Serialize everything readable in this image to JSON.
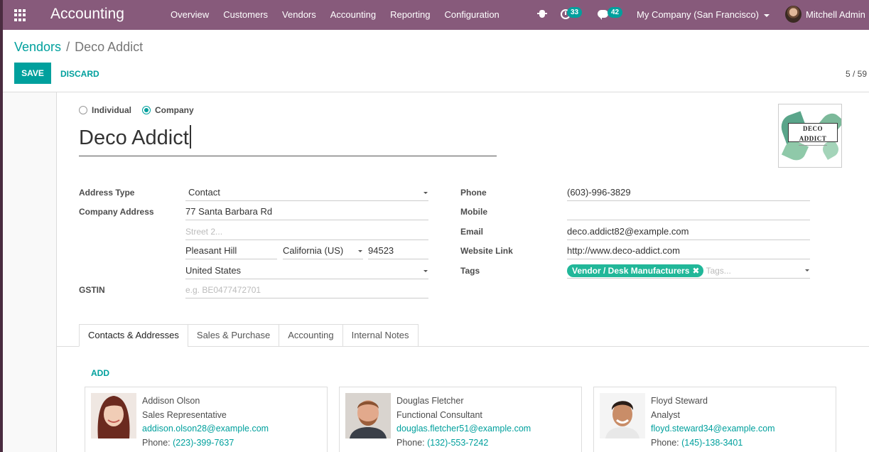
{
  "navbar": {
    "brand": "Accounting",
    "menu": [
      "Overview",
      "Customers",
      "Vendors",
      "Accounting",
      "Reporting",
      "Configuration"
    ],
    "activity_count": "33",
    "message_count": "42",
    "company": "My Company (San Francisco)",
    "user": "Mitchell Admin"
  },
  "breadcrumb": {
    "parent": "Vendors",
    "separator": "/",
    "current": "Deco Addict"
  },
  "buttons": {
    "save": "SAVE",
    "discard": "DISCARD"
  },
  "pager": "5 / 59",
  "form": {
    "company_type": {
      "individual": "Individual",
      "company": "Company",
      "selected": "company"
    },
    "name": "Deco Addict",
    "logo_text": "DECO ADDICT",
    "left": {
      "address_type_label": "Address Type",
      "address_type": "Contact",
      "company_address_label": "Company Address",
      "street": "77 Santa Barbara Rd",
      "street2_placeholder": "Street 2...",
      "city": "Pleasant Hill",
      "state": "California (US)",
      "zip": "94523",
      "country": "United States",
      "gstin_label": "GSTIN",
      "gstin_placeholder": "e.g. BE0477472701"
    },
    "right": {
      "phone_label": "Phone",
      "phone": "(603)-996-3829",
      "mobile_label": "Mobile",
      "mobile": "",
      "email_label": "Email",
      "email": "deco.addict82@example.com",
      "website_label": "Website Link",
      "website": "http://www.deco-addict.com",
      "tags_label": "Tags",
      "tag": "Vendor / Desk Manufacturers",
      "tags_placeholder": "Tags..."
    }
  },
  "tabs": [
    "Contacts & Addresses",
    "Sales & Purchase",
    "Accounting",
    "Internal Notes"
  ],
  "add_label": "ADD",
  "contacts": [
    {
      "name": "Addison Olson",
      "title": "Sales Representative",
      "email": "addison.olson28@example.com",
      "phone_label": "Phone:",
      "phone": "(223)-399-7637"
    },
    {
      "name": "Douglas Fletcher",
      "title": "Functional Consultant",
      "email": "douglas.fletcher51@example.com",
      "phone_label": "Phone:",
      "phone": "(132)-553-7242"
    },
    {
      "name": "Floyd Steward",
      "title": "Analyst",
      "email": "floyd.steward34@example.com",
      "phone_label": "Phone:",
      "phone": "(145)-138-3401"
    }
  ],
  "colors": {
    "navbar": "#875a7b",
    "accent": "#00a09d",
    "tag": "#21b799"
  }
}
